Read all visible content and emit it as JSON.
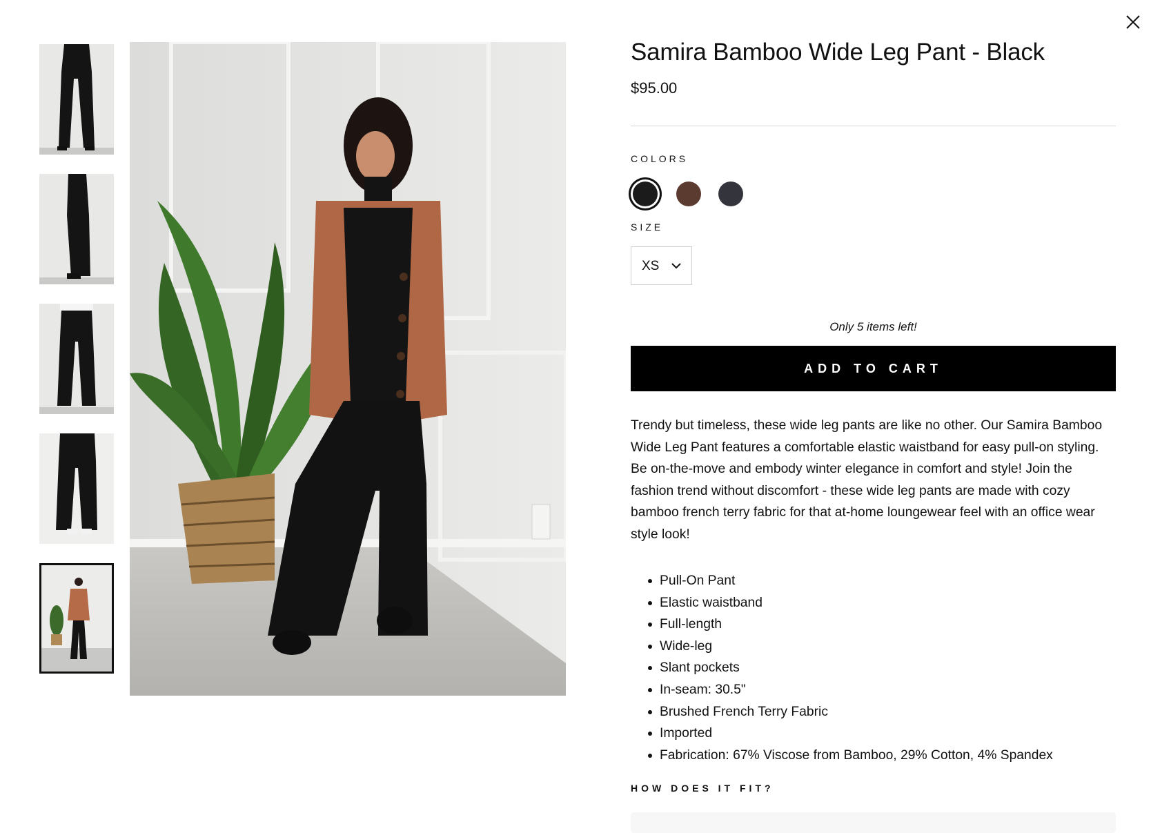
{
  "close": {
    "icon": "close-icon"
  },
  "thumbnails": [
    {
      "alt": "Front view of black wide leg pants"
    },
    {
      "alt": "Side view of black wide leg pants"
    },
    {
      "alt": "Back view of black wide leg pants"
    },
    {
      "alt": "Hands in pockets view"
    },
    {
      "alt": "Full outfit with cardigan",
      "active": true
    }
  ],
  "product": {
    "title": "Samira Bamboo Wide Leg Pant - Black",
    "price": "$95.00",
    "colors_label": "COLORS",
    "colors": [
      {
        "name": "Black",
        "hex": "#1b1b1b",
        "selected": true
      },
      {
        "name": "Brown",
        "hex": "#5b3a30",
        "selected": false
      },
      {
        "name": "Charcoal",
        "hex": "#33343c",
        "selected": false
      }
    ],
    "size_label": "SIZE",
    "size_selected": "XS",
    "stock_message": "Only 5 items left!",
    "add_to_cart": "ADD TO CART",
    "description": "Trendy but timeless, these wide leg pants are like no other. Our Samira Bamboo Wide Leg Pant features a comfortable elastic waistband for easy pull-on styling. Be on-the-move and embody winter elegance in comfort and style! Join the fashion trend without discomfort - these wide leg pants are made with cozy bamboo french terry fabric for that at-home loungewear feel with an office wear style look!",
    "features": [
      "Pull-On Pant",
      "Elastic waistband",
      "Full-length",
      "Wide-leg",
      "Slant pockets",
      "In-seam: 30.5\"",
      "Brushed French Terry Fabric",
      "Imported",
      "Fabrication: 67% Viscose from Bamboo, 29% Cotton, 4% Spandex"
    ],
    "fit_label": "HOW DOES IT FIT?"
  }
}
